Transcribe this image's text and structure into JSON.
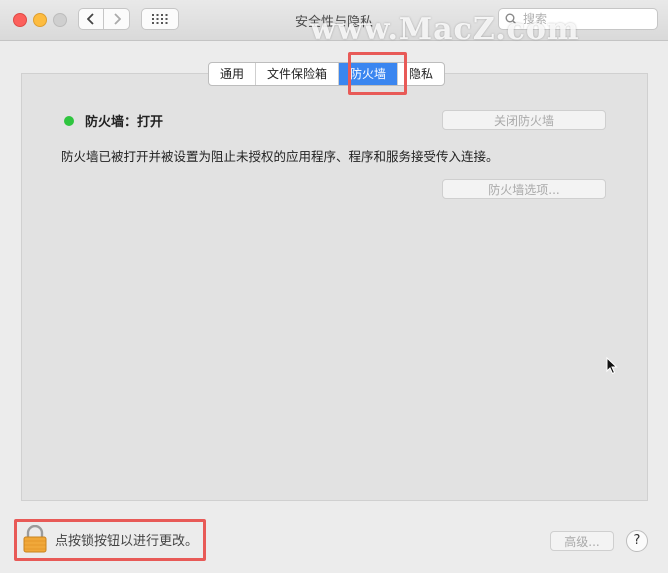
{
  "window": {
    "title": "安全性与隐私",
    "watermark": "www.MacZ.com"
  },
  "toolbar": {
    "back_icon": "chevron-left-icon",
    "forward_icon": "chevron-right-icon",
    "grid_icon": "grid-icon",
    "search_placeholder": "搜索"
  },
  "tabs": [
    {
      "label": "通用",
      "active": false
    },
    {
      "label": "文件保险箱",
      "active": false
    },
    {
      "label": "防火墙",
      "active": true
    },
    {
      "label": "隐私",
      "active": false
    }
  ],
  "firewall": {
    "status_color": "#2fc53f",
    "status_label": "防火墙：打开",
    "turn_off_button": "关闭防火墙",
    "description": "防火墙已被打开并被设置为阻止未授权的应用程序、程序和服务接受传入连接。",
    "options_button": "防火墙选项..."
  },
  "footer": {
    "lock_text": "点按锁按钮以进行更改。",
    "advanced_button": "高级...",
    "help_label": "?"
  },
  "colors": {
    "highlight": "#e85a57",
    "tab_active": "#3a86f0"
  }
}
